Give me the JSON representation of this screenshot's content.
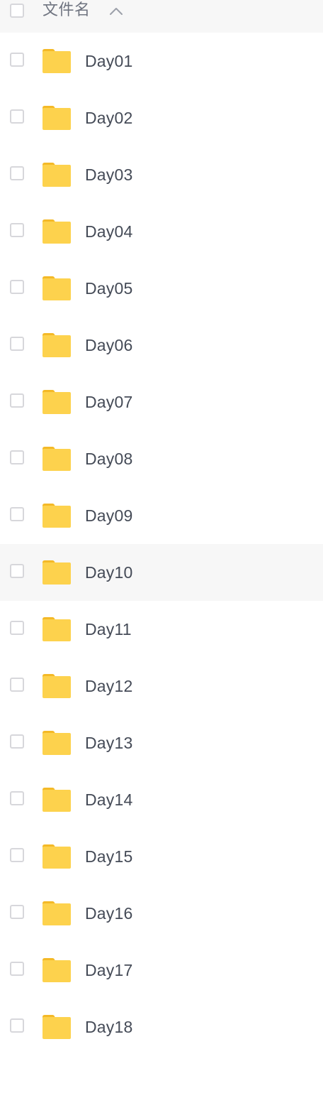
{
  "header": {
    "column_label": "文件名",
    "sort_icon": "chevron-up-icon"
  },
  "rows": [
    {
      "name": "Day01",
      "icon": "folder-icon"
    },
    {
      "name": "Day02",
      "icon": "folder-icon"
    },
    {
      "name": "Day03",
      "icon": "folder-icon"
    },
    {
      "name": "Day04",
      "icon": "folder-icon"
    },
    {
      "name": "Day05",
      "icon": "folder-icon"
    },
    {
      "name": "Day06",
      "icon": "folder-icon"
    },
    {
      "name": "Day07",
      "icon": "folder-icon"
    },
    {
      "name": "Day08",
      "icon": "folder-icon"
    },
    {
      "name": "Day09",
      "icon": "folder-icon"
    },
    {
      "name": "Day10",
      "icon": "folder-icon"
    },
    {
      "name": "Day11",
      "icon": "folder-icon"
    },
    {
      "name": "Day12",
      "icon": "folder-icon"
    },
    {
      "name": "Day13",
      "icon": "folder-icon"
    },
    {
      "name": "Day14",
      "icon": "folder-icon"
    },
    {
      "name": "Day15",
      "icon": "folder-icon"
    },
    {
      "name": "Day16",
      "icon": "folder-icon"
    },
    {
      "name": "Day17",
      "icon": "folder-icon"
    },
    {
      "name": "Day18",
      "icon": "folder-icon"
    }
  ],
  "colors": {
    "folder": "#FDD24D",
    "folder_tab": "#F4B927",
    "row_hover": "#F7F7F7",
    "checkbox_border": "#D7D7DB"
  }
}
